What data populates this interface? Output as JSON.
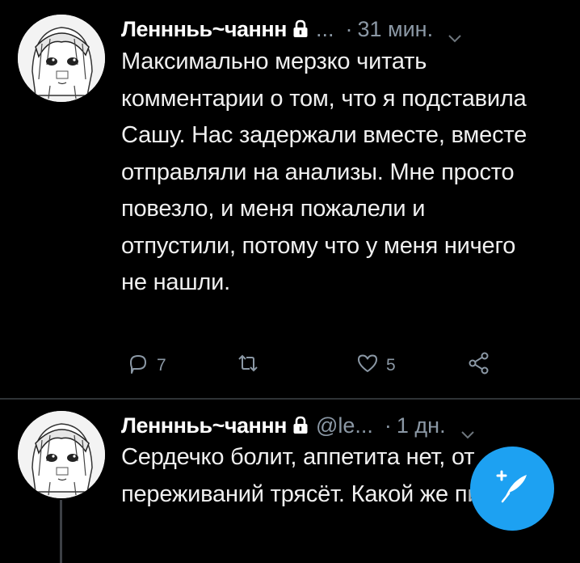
{
  "tweets": [
    {
      "name": "Леннньь~чаннн",
      "handle": "...",
      "separator": "·",
      "time": "31 мин.",
      "text": "Максимально мерзко читать комментарии о том, что я подставила Сашу. Нас задержали вместе, вместе отправляли на анализы. Мне просто повезло, и меня пожалели и отпустили, потому что у меня ничего не нашли.",
      "reply_count": "7",
      "like_count": "5"
    },
    {
      "name": "Леннньь~чаннн",
      "handle": "@le...",
      "separator": "·",
      "time": "1 дн.",
      "text": "Сердечко болит, аппетита нет, от переживаний трясёт. Какой же пиздец."
    }
  ],
  "icons": {
    "lock": "lock-icon",
    "more": "chevron-down-icon",
    "reply": "reply-icon",
    "retweet": "retweet-icon",
    "like": "heart-icon",
    "share": "share-icon",
    "compose": "compose-tweet-icon"
  },
  "colors": {
    "background": "#000000",
    "secondary_text": "#8b98a5",
    "accent": "#1da1f2",
    "divider": "#2f3336"
  }
}
